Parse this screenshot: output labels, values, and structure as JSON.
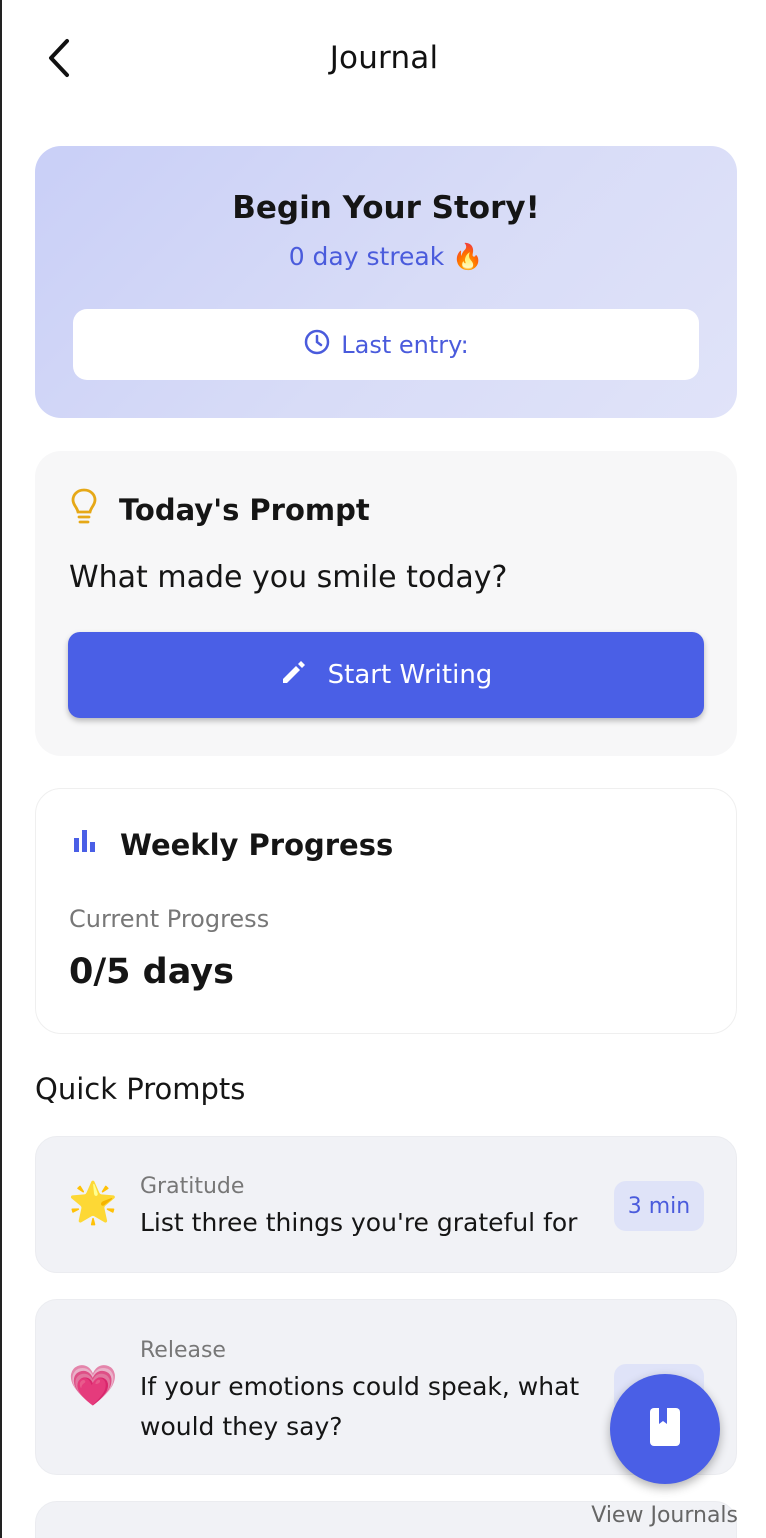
{
  "header": {
    "title": "Journal",
    "back_icon": "chevron-left-icon"
  },
  "story": {
    "title": "Begin Your Story!",
    "streak": "0 day streak 🔥",
    "last_entry_label": "Last entry:",
    "last_entry_icon": "clock-icon"
  },
  "prompt": {
    "heading": "Today's Prompt",
    "heading_icon": "lightbulb-icon",
    "text": "What made you smile today?",
    "button_label": "Start Writing",
    "button_icon": "pencil-icon"
  },
  "weekly": {
    "heading": "Weekly Progress",
    "heading_icon": "bar-chart-icon",
    "label": "Current Progress",
    "value": "0/5 days",
    "progress_fraction": 0.0
  },
  "quick_prompts": {
    "heading": "Quick Prompts",
    "items": [
      {
        "emoji": "🌟",
        "category": "Gratitude",
        "text": "List three things you're grateful for",
        "duration": "3 min"
      },
      {
        "emoji": "💗",
        "category": "Release",
        "text": "If your emotions could speak, what would they say?",
        "duration": ""
      }
    ]
  },
  "fab": {
    "label": "View Journals",
    "icon": "book-icon"
  },
  "colors": {
    "accent": "#4a5fe6",
    "accent_text": "#4a5bdc",
    "story_bg": "#d3d8f7",
    "prompt_bg": "#f7f7f8",
    "lightbulb": "#e6a817"
  }
}
